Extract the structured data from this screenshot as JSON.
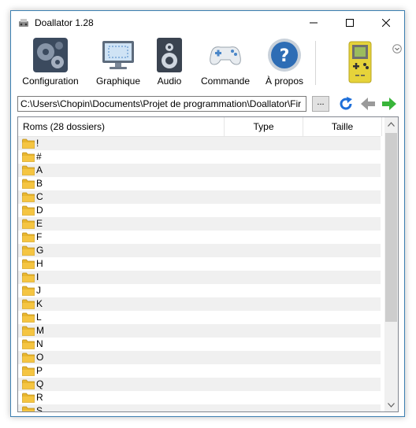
{
  "window": {
    "title": "Doallator 1.28",
    "controls": {
      "minimize": "—",
      "maximize": "☐",
      "close": "✕"
    }
  },
  "toolbar": {
    "buttons": [
      {
        "label": "Configuration",
        "icon": "gears-icon"
      },
      {
        "label": "Graphique",
        "icon": "monitor-icon"
      },
      {
        "label": "Audio",
        "icon": "speaker-icon"
      },
      {
        "label": "Commande",
        "icon": "gamepad-icon"
      },
      {
        "label": "À propos",
        "icon": "help-icon"
      }
    ],
    "console_icon": "game-boy-icon",
    "collapse_icon": "chevron-down-circle-icon"
  },
  "pathbar": {
    "value": "C:\\Users\\Chopin\\Documents\\Projet de programmation\\Doallator\\Fir",
    "browse_label": "...",
    "refresh_icon": "refresh-icon",
    "back_icon": "arrow-left-icon",
    "forward_icon": "arrow-right-icon"
  },
  "list": {
    "columns": [
      "Roms (28 dossiers)",
      "Type",
      "Taille"
    ],
    "rows": [
      "!",
      "#",
      "A",
      "B",
      "C",
      "D",
      "E",
      "F",
      "G",
      "H",
      "I",
      "J",
      "K",
      "L",
      "M",
      "N",
      "O",
      "P",
      "Q",
      "R",
      "S"
    ],
    "folder_icon": "folder-icon"
  },
  "colors": {
    "accent_border": "#3c7fb1",
    "alt_row": "#f0f0f0",
    "refresh_blue": "#1e6fd9",
    "forward_green": "#39b53a",
    "back_gray": "#9a9a9a",
    "folder_yellow": "#f5c542"
  }
}
